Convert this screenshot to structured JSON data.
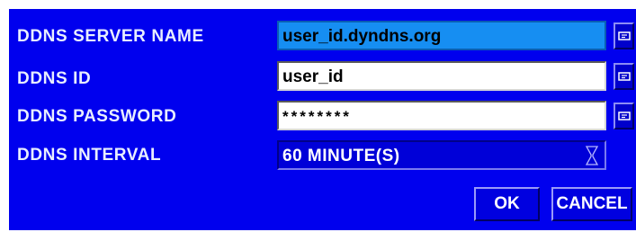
{
  "form": {
    "server_name": {
      "label": "DDNS SERVER NAME",
      "value": "user_id.dyndns.org"
    },
    "id": {
      "label": "DDNS ID",
      "value": "user_id"
    },
    "password": {
      "label": "DDNS PASSWORD",
      "value": "********"
    },
    "interval": {
      "label": "DDNS INTERVAL",
      "value": "60 MINUTE(S)"
    }
  },
  "buttons": {
    "ok_label": "OK",
    "cancel_label": "CANCEL"
  },
  "icons": {
    "keyboard_button": "virtual-keyboard-icon",
    "dropdown": "hourglass-dropdown-icon"
  },
  "colors": {
    "panel_background": "#0000ee",
    "focused_field": "#168ef2",
    "text_field": "#ffffff",
    "label_text": "#e8eeff"
  }
}
